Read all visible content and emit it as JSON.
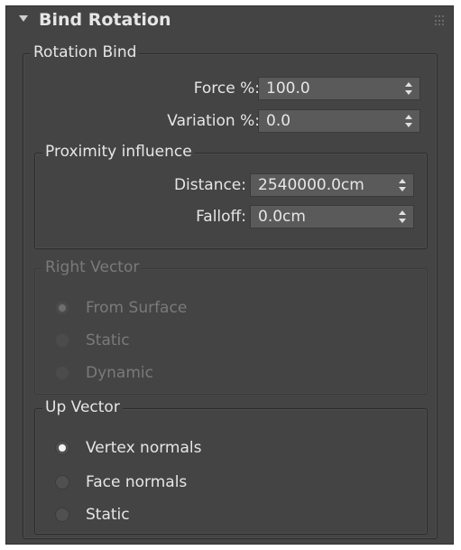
{
  "rollout": {
    "title": "Bind Rotation"
  },
  "rotation_bind": {
    "label": "Rotation Bind",
    "force": {
      "label": "Force %:",
      "value": "100.0"
    },
    "variation": {
      "label": "Variation %:",
      "value": "0.0"
    }
  },
  "proximity": {
    "label": "Proximity influence",
    "distance": {
      "label": "Distance:",
      "value": "2540000.0cm"
    },
    "falloff": {
      "label": "Falloff:",
      "value": "0.0cm"
    }
  },
  "right_vector": {
    "label": "Right Vector",
    "options": [
      {
        "label": "From Surface",
        "checked": true
      },
      {
        "label": "Static",
        "checked": false
      },
      {
        "label": "Dynamic",
        "checked": false
      }
    ]
  },
  "up_vector": {
    "label": "Up Vector",
    "options": [
      {
        "label": "Vertex normals",
        "checked": true
      },
      {
        "label": "Face normals",
        "checked": false
      },
      {
        "label": "Static",
        "checked": false
      }
    ]
  },
  "colors": {
    "panel_bg": "#444444",
    "spinner_bg": "#5a5a5a",
    "text": "#e6e6e6",
    "disabled_text": "#7a7a7a"
  }
}
